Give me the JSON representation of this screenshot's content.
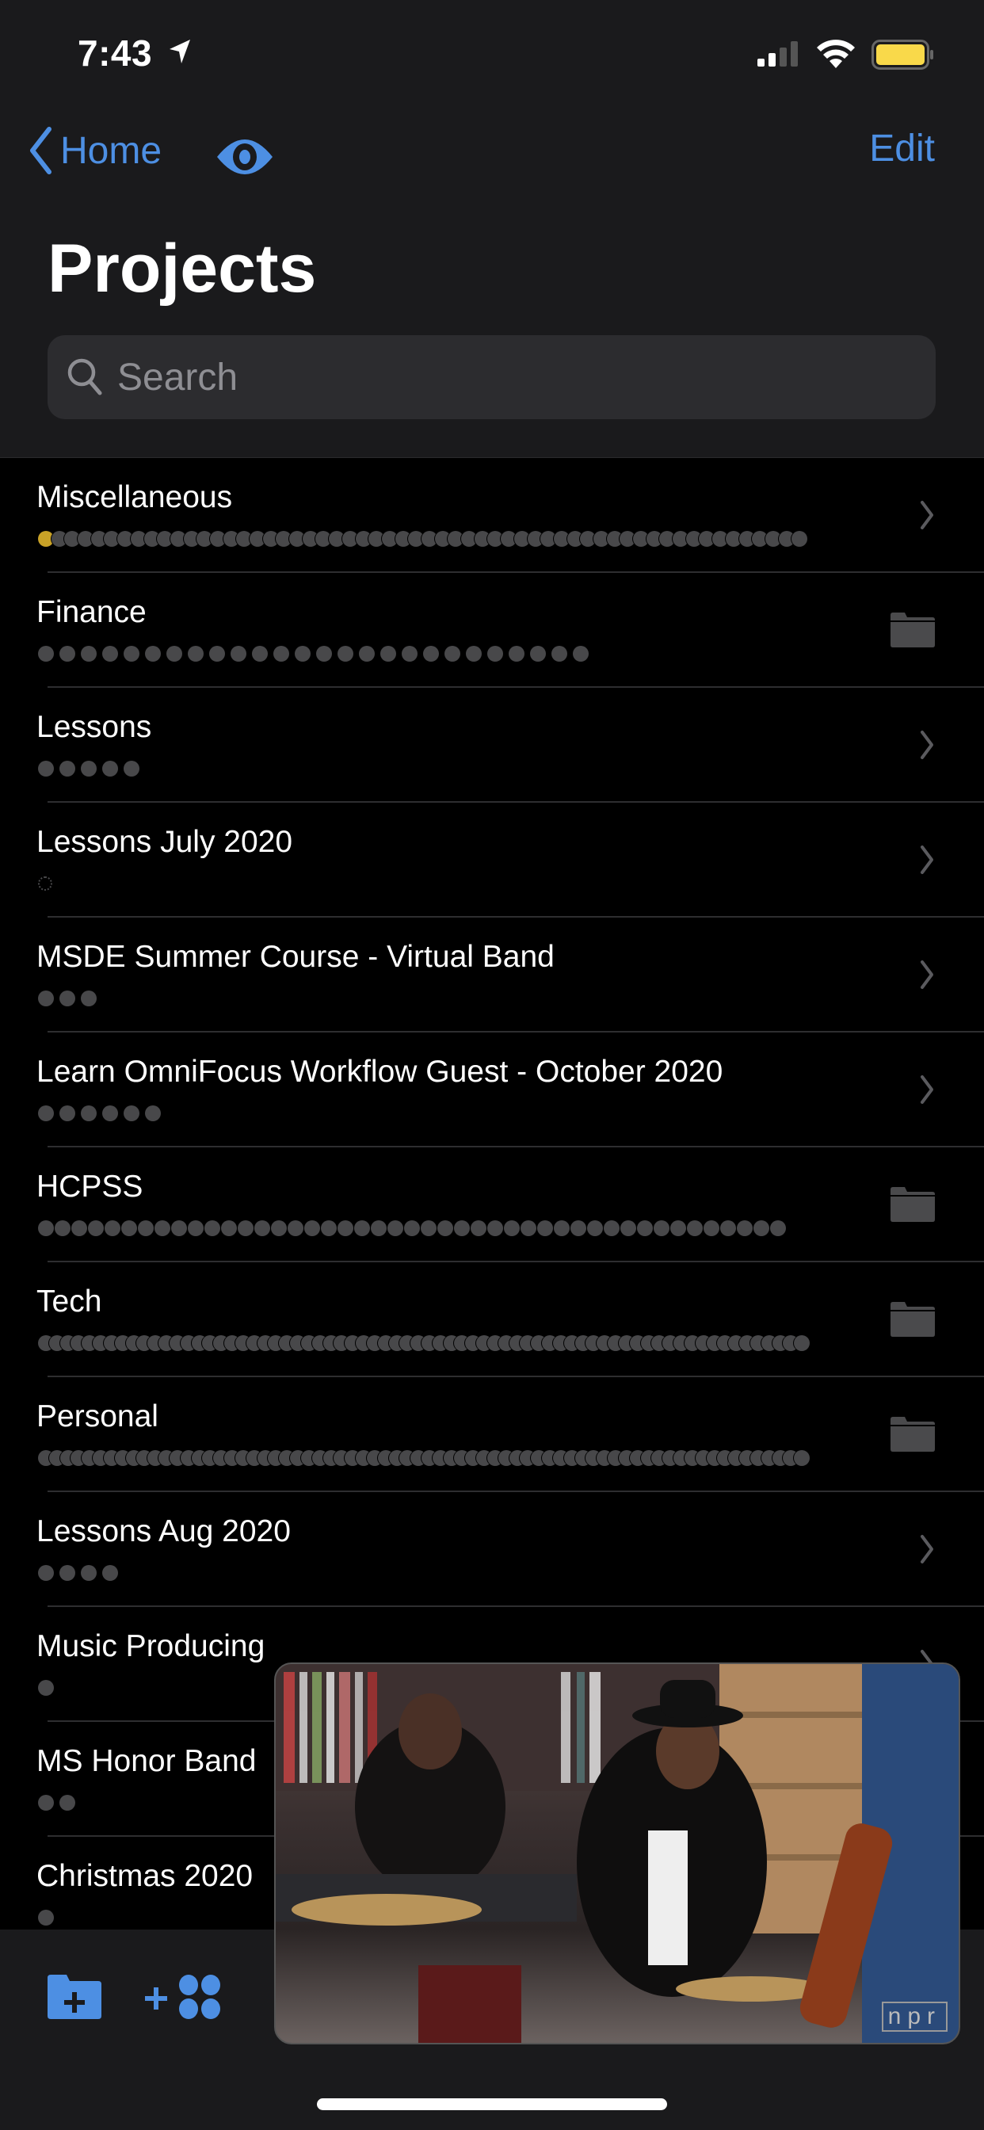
{
  "status_bar": {
    "time": "7:43",
    "location_icon": "location-arrow-icon",
    "signal_icon": "cellular-signal-icon",
    "wifi_icon": "wifi-icon",
    "battery_icon": "battery-icon",
    "battery_color": "#f9d94a"
  },
  "nav": {
    "back_label": "Home",
    "eye_icon": "eye-icon",
    "edit_label": "Edit",
    "accent": "#4d8fe3"
  },
  "title": "Projects",
  "search": {
    "placeholder": "Search",
    "value": ""
  },
  "projects": [
    {
      "name": "Miscellaneous",
      "dots": 58,
      "first_dot_color": "#c9a227",
      "accessory": "chevron"
    },
    {
      "name": "Finance",
      "dots": 26,
      "accessory": "folder"
    },
    {
      "name": "Lessons",
      "dots": 5,
      "accessory": "chevron"
    },
    {
      "name": "Lessons July 2020",
      "dots": 0,
      "accessory": "chevron"
    },
    {
      "name": "MSDE Summer Course - Virtual Band",
      "dots": 3,
      "accessory": "chevron"
    },
    {
      "name": "Learn OmniFocus Workflow Guest - October 2020",
      "dots": 6,
      "accessory": "chevron"
    },
    {
      "name": "HCPSS",
      "dots": 45,
      "accessory": "folder"
    },
    {
      "name": "Tech",
      "dots": 70,
      "accessory": "folder"
    },
    {
      "name": "Personal",
      "dots": 70,
      "accessory": "folder"
    },
    {
      "name": "Lessons Aug 2020",
      "dots": 4,
      "accessory": "chevron"
    },
    {
      "name": "Music Producing",
      "dots": 1,
      "accessory": "chevron"
    },
    {
      "name": "MS Honor Band",
      "dots": 2,
      "accessory": "chevron"
    },
    {
      "name": "Christmas 2020",
      "dots": 1,
      "accessory": "chevron"
    }
  ],
  "toolbar": {
    "new_folder_icon": "folder-plus-icon",
    "new_project_icon": "add-project-icon"
  },
  "pip_video": {
    "watermark": "npr"
  }
}
